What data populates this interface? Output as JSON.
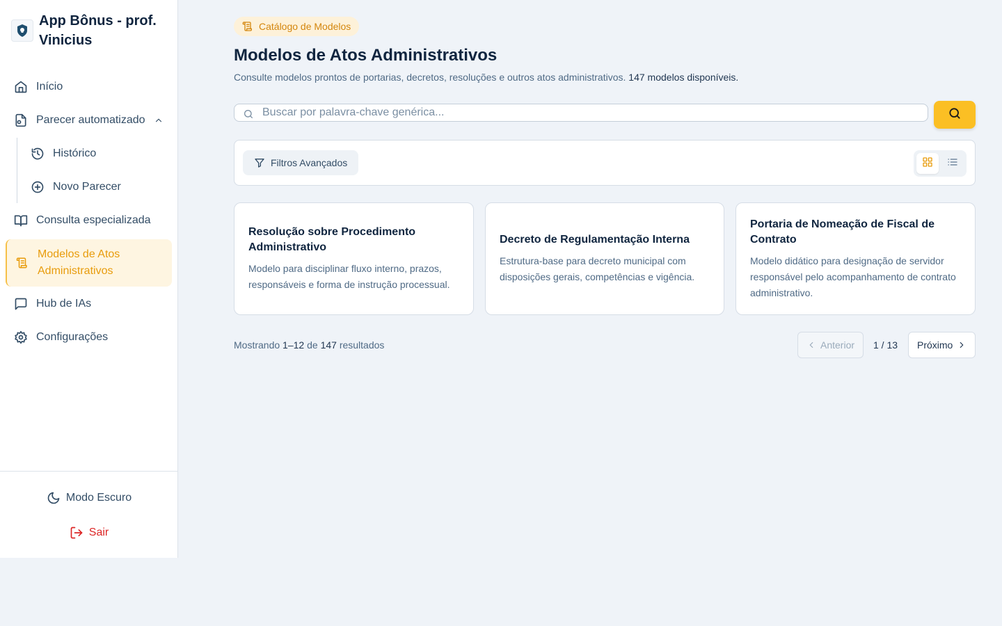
{
  "sidebar": {
    "brand_title": "App Bônus - prof. Vinicius",
    "items": [
      {
        "label": "Início",
        "icon": "home-icon"
      },
      {
        "label": "Parecer automatizado",
        "icon": "document-icon",
        "expanded": true
      },
      {
        "label": "Histórico",
        "icon": "history-icon"
      },
      {
        "label": "Novo Parecer",
        "icon": "plus-circle-icon"
      },
      {
        "label": "Consulta especializada",
        "icon": "book-open-icon"
      },
      {
        "label": "Modelos de Atos Administrativos",
        "icon": "scroll-icon",
        "active": true
      },
      {
        "label": "Hub de IAs",
        "icon": "chat-icon"
      },
      {
        "label": "Configurações",
        "icon": "gear-icon"
      }
    ],
    "footer": {
      "dark_mode_label": "Modo Escuro",
      "logout_label": "Sair"
    }
  },
  "main": {
    "badge": "Catálogo de Modelos",
    "title": "Modelos de Atos Administrativos",
    "subtitle": "Consulte modelos prontos de portarias, decretos, resoluções e outros atos administrativos.",
    "subtitle_count": "147 modelos disponíveis.",
    "search": {
      "placeholder": "Buscar por palavra-chave genérica..."
    },
    "filters_label": "Filtros Avançados",
    "view_mode": "grid",
    "cards": [
      {
        "title": "Resolução sobre Procedimento Administrativo",
        "description": "Modelo para disciplinar fluxo interno, prazos, responsáveis e forma de instrução processual."
      },
      {
        "title": "Decreto de Regulamentação Interna",
        "description": "Estrutura-base para decreto municipal com disposições gerais, competências e vigência."
      },
      {
        "title": "Portaria de Nomeação de Fiscal de Contrato",
        "description": "Modelo didático para designação de servidor responsável pelo acompanhamento de contrato administrativo."
      }
    ],
    "results": {
      "prefix": "Mostrando",
      "range": "1–12",
      "of": "de",
      "total": "147",
      "suffix": "resultados"
    },
    "pagination": {
      "prev_label": "Anterior",
      "next_label": "Próximo",
      "page_info": "1 / 13"
    }
  },
  "colors": {
    "accent": "#fbbf24",
    "accent_text": "#e89c0c",
    "danger": "#dc2626"
  }
}
